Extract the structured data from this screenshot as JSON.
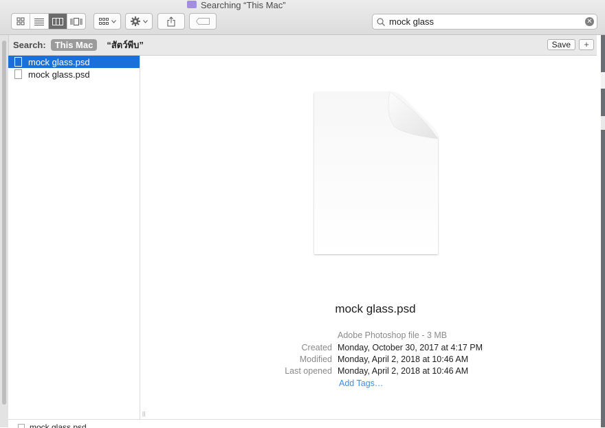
{
  "window": {
    "title": "Searching “This Mac”"
  },
  "toolbar": {
    "view_buttons": [
      "icon-view",
      "list-view",
      "column-view",
      "cover-flow-view"
    ],
    "active_view": "column-view",
    "arrange_icon": "grid-arrange-icon",
    "action_icon": "gear-icon",
    "share_icon": "share-icon",
    "tag_icon": "tag-icon"
  },
  "search": {
    "value": "mock glass",
    "icon": "magnifier-icon",
    "clear_icon": "clear-icon"
  },
  "scope_bar": {
    "label": "Search:",
    "selected_scope": "This Mac",
    "other_scope": "“สัตว์พีบ”",
    "save_label": "Save",
    "add_label": "+"
  },
  "results": [
    {
      "name": "mock glass.psd",
      "selected": true
    },
    {
      "name": "mock glass.psd",
      "selected": false
    }
  ],
  "preview": {
    "file_name": "mock glass.psd",
    "kind": "Adobe Photoshop file - 3 MB",
    "rows": [
      {
        "label": "Created",
        "value": "Monday, October 30, 2017 at 4:17 PM"
      },
      {
        "label": "Modified",
        "value": "Monday, April 2, 2018 at 10:46 AM"
      },
      {
        "label": "Last opened",
        "value": "Monday, April 2, 2018 at 10:46 AM"
      }
    ],
    "add_tags": "Add Tags…"
  },
  "path_bar": {
    "item": "mock glass.psd"
  },
  "colors": {
    "selection": "#1a6fd9",
    "link": "#3a8ef0",
    "scope_selected": "#9b9b9b"
  }
}
